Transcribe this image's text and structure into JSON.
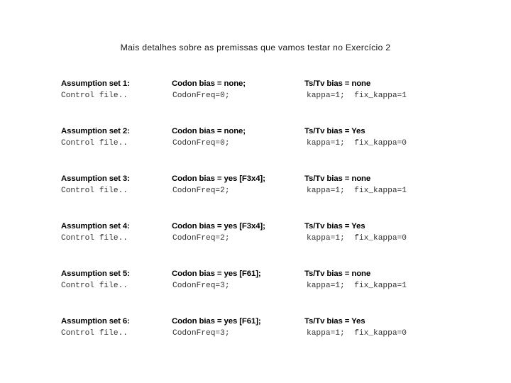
{
  "slide": {
    "title": "Mais detalhes sobre as premissas que vamos testar no Exercício 2",
    "background_color": "#ffffff",
    "text_color": "#000000",
    "mono_text_color": "#333333"
  },
  "assumption_sets": [
    {
      "label": "Assumption set 1:",
      "control_file": "Control file..",
      "codon_bias": "Codon bias = none;",
      "codon_freq": "CodonFreq=0;",
      "tstv_bias": "Ts/Tv bias = none",
      "kappa": "kappa=1;  fix_kappa=1"
    },
    {
      "label": "Assumption set 2:",
      "control_file": "Control file..",
      "codon_bias": "Codon bias = none;",
      "codon_freq": "CodonFreq=0;",
      "tstv_bias": "Ts/Tv bias = Yes",
      "kappa": "kappa=1;  fix_kappa=0"
    },
    {
      "label": "Assumption set 3:",
      "control_file": "Control file..",
      "codon_bias": "Codon bias = yes [F3x4];",
      "codon_freq": "CodonFreq=2;",
      "tstv_bias": "Ts/Tv bias = none",
      "kappa": "kappa=1;  fix_kappa=1"
    },
    {
      "label": "Assumption set 4:",
      "control_file": "Control file..",
      "codon_bias": "Codon bias = yes [F3x4];",
      "codon_freq": "CodonFreq=2;",
      "tstv_bias": "Ts/Tv bias = Yes",
      "kappa": "kappa=1;  fix_kappa=0"
    },
    {
      "label": "Assumption set 5:",
      "control_file": "Control file..",
      "codon_bias": "Codon bias = yes [F61];",
      "codon_freq": "CodonFreq=3;",
      "tstv_bias": "Ts/Tv bias = none",
      "kappa": "kappa=1;  fix_kappa=1"
    },
    {
      "label": "Assumption set 6:",
      "control_file": "Control file..",
      "codon_bias": "Codon bias = yes [F61];",
      "codon_freq": "CodonFreq=3;",
      "tstv_bias": "Ts/Tv bias = Yes",
      "kappa": "kappa=1;  fix_kappa=0"
    }
  ],
  "layout": {
    "block_top_start": 110,
    "block_pitch": 67
  }
}
